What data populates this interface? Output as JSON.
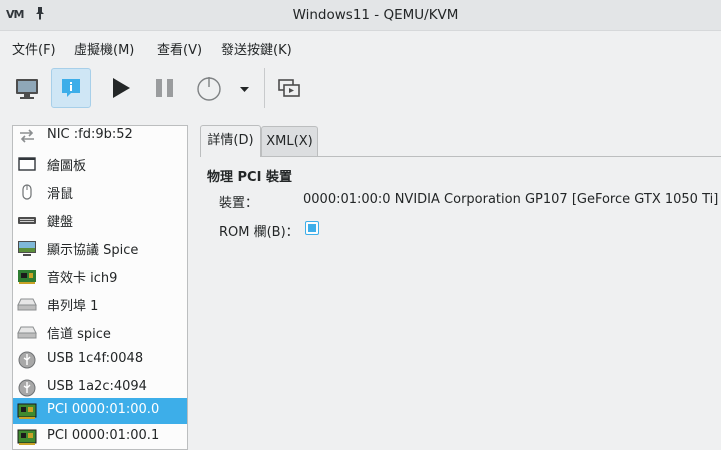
{
  "window": {
    "logo": "VM",
    "title": "Windows11 - QEMU/KVM"
  },
  "menu": [
    "文件(F)",
    "虛擬機(M)",
    "查看(V)",
    "發送按鍵(K)"
  ],
  "toolbar": {
    "buttons": [
      {
        "name": "console-button",
        "icon": "monitor-icon",
        "active": false
      },
      {
        "name": "details-button",
        "icon": "info-icon",
        "active": true
      },
      {
        "name": "run-button",
        "icon": "play-icon",
        "active": false
      },
      {
        "name": "pause-button",
        "icon": "pause-icon",
        "active": false
      },
      {
        "name": "shutdown-button",
        "icon": "power-icon",
        "active": false
      },
      {
        "name": "shutdown-menu-button",
        "icon": "dropdown-arrow-icon",
        "active": false
      },
      {
        "name": "fullscreen-button",
        "icon": "fullscreen-icon",
        "active": false
      }
    ]
  },
  "sidebar": {
    "items": [
      {
        "label": "NIC :fd:9b:52",
        "icon": "network-icon"
      },
      {
        "label": "繪圖板",
        "icon": "tablet-icon"
      },
      {
        "label": "滑鼠",
        "icon": "mouse-icon"
      },
      {
        "label": "鍵盤",
        "icon": "keyboard-icon"
      },
      {
        "label": "顯示協議 Spice",
        "icon": "display-icon"
      },
      {
        "label": "音效卡 ich9",
        "icon": "sound-card-icon"
      },
      {
        "label": "串列埠 1",
        "icon": "serial-port-icon"
      },
      {
        "label": "信道 spice",
        "icon": "channel-icon"
      },
      {
        "label": "USB 1c4f:0048",
        "icon": "usb-icon"
      },
      {
        "label": "USB 1a2c:4094",
        "icon": "usb-icon"
      },
      {
        "label": "PCI 0000:01:00.0",
        "icon": "pci-card-icon",
        "selected": true
      },
      {
        "label": "PCI 0000:01:00.1",
        "icon": "pci-card-icon"
      }
    ]
  },
  "tabs": [
    {
      "label": "詳情(D)",
      "active": true
    },
    {
      "label": "XML(X)",
      "active": false
    }
  ],
  "details": {
    "section_title": "物理 PCI 裝置",
    "device_label": "裝置：",
    "device_value": "0000:01:00:0 NVIDIA Corporation GP107 [GeForce GTX 1050 Ti]",
    "rom_label": "ROM 欄(B)：",
    "rom_checked": true
  },
  "colors": {
    "accent": "#3daee9",
    "window_bg": "#eff0f1",
    "list_bg": "#fcfcfc"
  }
}
